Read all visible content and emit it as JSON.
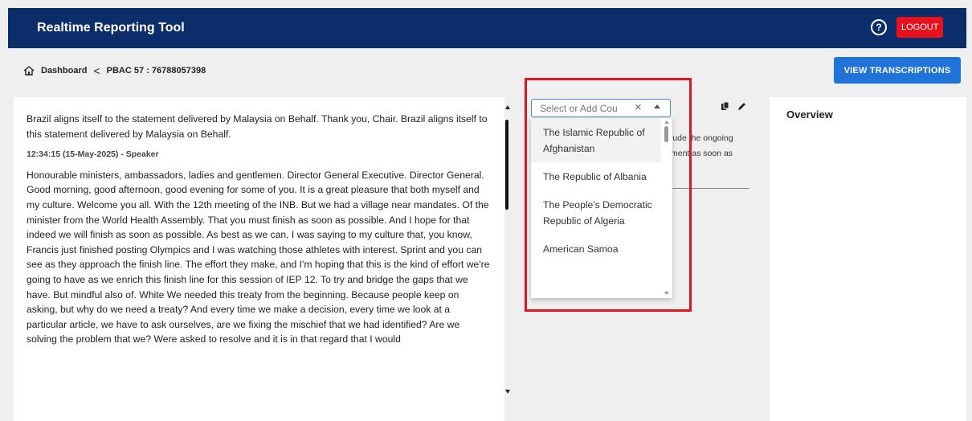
{
  "header": {
    "title": "Realtime Reporting Tool",
    "help_icon": "?",
    "logout_label": "LOGOUT",
    "brand_color": "#0b2e6b",
    "logout_color": "#e8121e"
  },
  "breadcrumb": {
    "home_label": "Dashboard",
    "separator": "<",
    "current": "PBAC 57 : 76788057398"
  },
  "actions": {
    "view_transcriptions_label": "VIEW TRANSCRIPTIONS"
  },
  "transcript": {
    "para1": "Brazil aligns itself to the statement delivered by Malaysia on Behalf. Thank you, Chair. Brazil aligns itself to this statement delivered by Malaysia on Behalf.",
    "meta": "12:34:15 (15-May-2025) - Speaker",
    "para2": "Honourable ministers, ambassadors, ladies and gentlemen. Director General Executive. Director General. Good morning, good afternoon, good evening for some of you. It is a great pleasure that both myself and my culture. Welcome you all. With the 12th meeting of the INB. But we had a village near mandates. Of the minister from the World Health Assembly. That you must finish as soon as possible. And I hope for that indeed we will finish as soon as possible. As best as we can, I was saying to my culture that, you know, Francis just finished posting Olympics and I was watching those athletes with interest. Sprint and you can see as they approach the finish line. The effort they make, and I'm hoping that this is the kind of effort we're going to have as we enrich this finish line for this session of IEP 12. To try and bridge the gaps that we have. But mindful also of. White We needed this treaty from the beginning. Because people keep on asking, but why do we need a treaty? And every time we make a decision, every time we look at a particular article, we have to ask ourselves, are we fixing the mischief that we had identified? Are we solving the problem that we? Were asked to resolve and it is in that regard that I would"
  },
  "summary_partial": {
    "line1": "lude the ongoing",
    "line2": "ment as soon as"
  },
  "country_select": {
    "placeholder": "Select or Add Cou",
    "clear_icon": "×",
    "options": [
      "The Islamic Republic of Afghanistan",
      "The Republic of Albania",
      "The People's Democratic Republic of Algeria",
      "American Samoa"
    ]
  },
  "tools": {
    "copy_icon": "copy-icon",
    "edit_icon": "pencil-icon"
  },
  "overview": {
    "title": "Overview"
  },
  "highlight_color": "#e0161e"
}
